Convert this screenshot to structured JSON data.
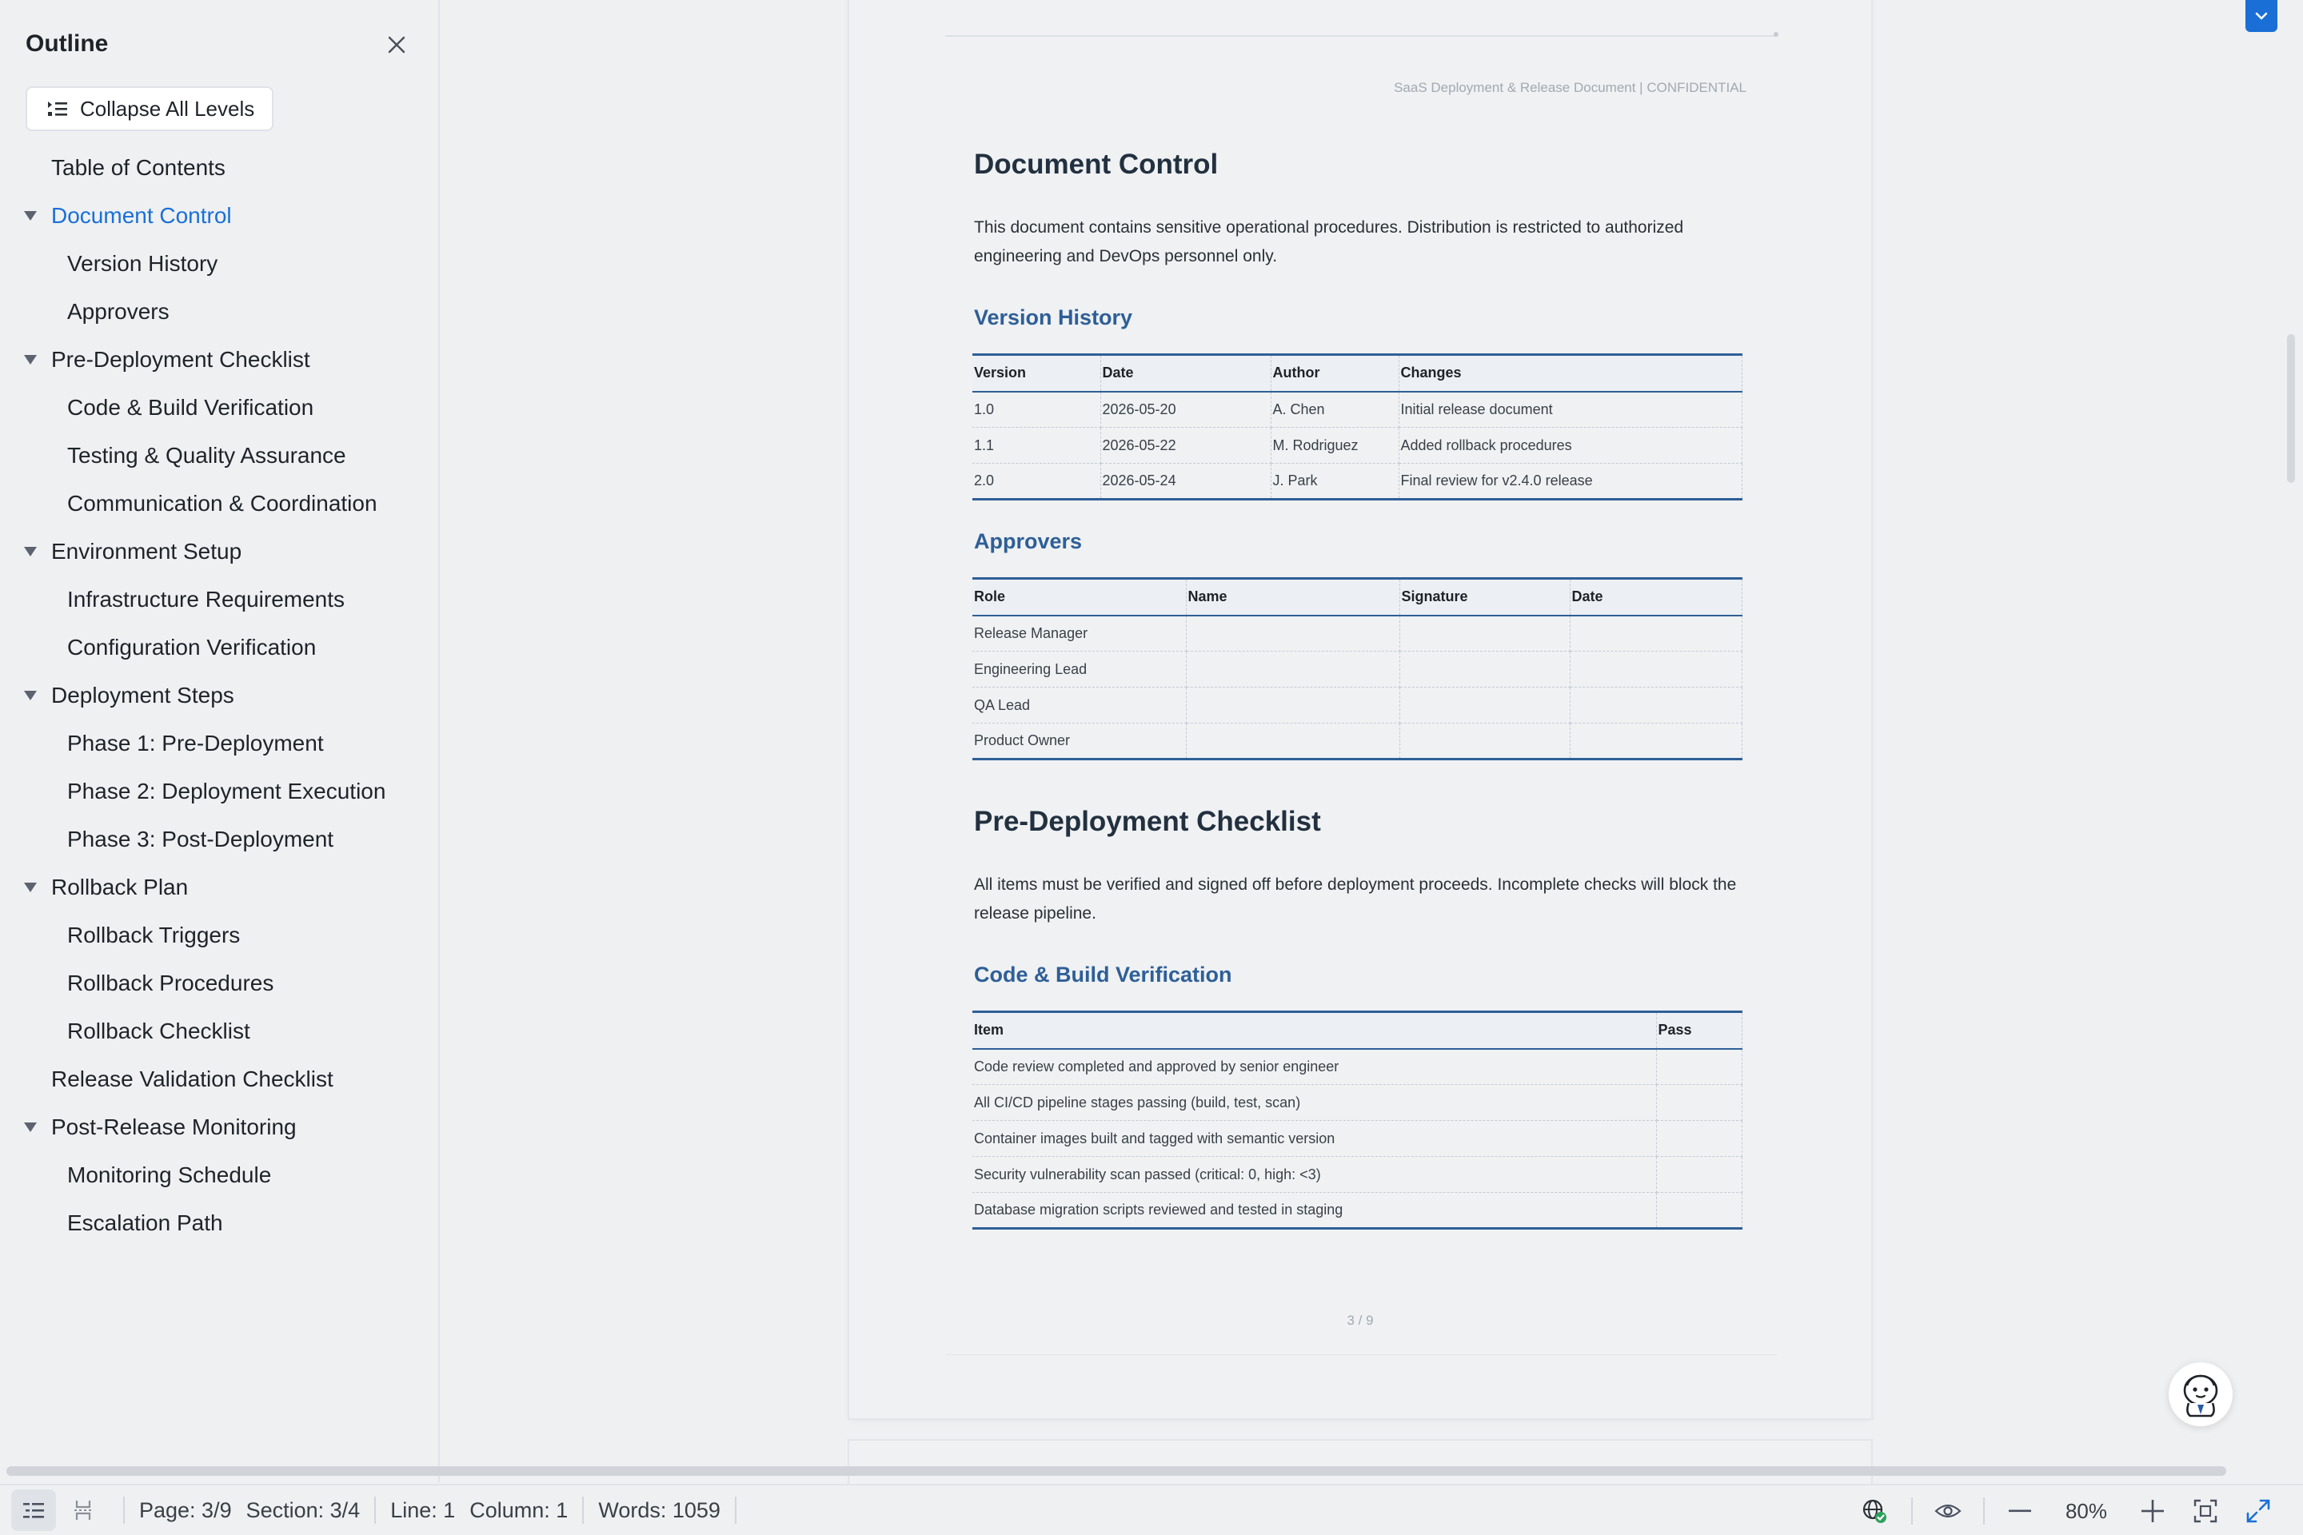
{
  "outline": {
    "title": "Outline",
    "collapse_label": "Collapse All Levels",
    "items": [
      {
        "label": "Table of Contents"
      },
      {
        "label": "Document Control"
      },
      {
        "label": "Version History"
      },
      {
        "label": "Approvers"
      },
      {
        "label": "Pre-Deployment Checklist"
      },
      {
        "label": "Code & Build Verification"
      },
      {
        "label": "Testing & Quality Assurance"
      },
      {
        "label": "Communication & Coordination"
      },
      {
        "label": "Environment Setup"
      },
      {
        "label": "Infrastructure Requirements"
      },
      {
        "label": "Configuration Verification"
      },
      {
        "label": "Deployment Steps"
      },
      {
        "label": "Phase 1: Pre-Deployment"
      },
      {
        "label": "Phase 2: Deployment Execution"
      },
      {
        "label": "Phase 3: Post-Deployment"
      },
      {
        "label": "Rollback Plan"
      },
      {
        "label": "Rollback Triggers"
      },
      {
        "label": "Rollback Procedures"
      },
      {
        "label": "Rollback Checklist"
      },
      {
        "label": "Release Validation Checklist"
      },
      {
        "label": "Post-Release Monitoring"
      },
      {
        "label": "Monitoring Schedule"
      },
      {
        "label": "Escalation Path"
      }
    ]
  },
  "document": {
    "header_text": "SaaS Deployment & Release Document  |  CONFIDENTIAL",
    "doc_control": {
      "heading": "Document Control",
      "paragraph": "This document contains sensitive operational procedures. Distribution is restricted to authorized engineering and DevOps personnel only."
    },
    "version_history": {
      "heading": "Version History",
      "columns": [
        "Version",
        "Date",
        "Author",
        "Changes"
      ],
      "rows": [
        [
          "1.0",
          "2026-05-20",
          "A. Chen",
          "Initial release document"
        ],
        [
          "1.1",
          "2026-05-22",
          "M. Rodriguez",
          "Added rollback procedures"
        ],
        [
          "2.0",
          "2026-05-24",
          "J. Park",
          "Final review for v2.4.0 release"
        ]
      ]
    },
    "approvers": {
      "heading": "Approvers",
      "columns": [
        "Role",
        "Name",
        "Signature",
        "Date"
      ],
      "rows": [
        [
          "Release Manager",
          "",
          "",
          ""
        ],
        [
          "Engineering Lead",
          "",
          "",
          ""
        ],
        [
          "QA Lead",
          "",
          "",
          ""
        ],
        [
          "Product Owner",
          "",
          "",
          ""
        ]
      ]
    },
    "pre_deployment": {
      "heading": "Pre-Deployment Checklist",
      "paragraph": "All items must be verified and signed off before deployment proceeds. Incomplete checks will block the release pipeline."
    },
    "code_build": {
      "heading": "Code & Build Verification",
      "columns": [
        "Item",
        "Pass"
      ],
      "rows": [
        [
          "Code review completed and approved by senior engineer",
          ""
        ],
        [
          "All CI/CD pipeline stages passing (build, test, scan)",
          ""
        ],
        [
          "Container images built and tagged with semantic version",
          ""
        ],
        [
          "Security vulnerability scan passed (critical: 0, high: <3)",
          ""
        ],
        [
          "Database migration scripts reviewed and tested in staging",
          ""
        ]
      ]
    },
    "page_number": "3 / 9"
  },
  "statusbar": {
    "page": "Page: 3/9",
    "section": "Section: 3/4",
    "line": "Line: 1",
    "column": "Column: 1",
    "words": "Words: 1059",
    "zoom": "80%"
  },
  "colors": {
    "accent": "#1a6fd6",
    "heading_blue": "#2e5f97",
    "heading_dark": "#22303f"
  }
}
